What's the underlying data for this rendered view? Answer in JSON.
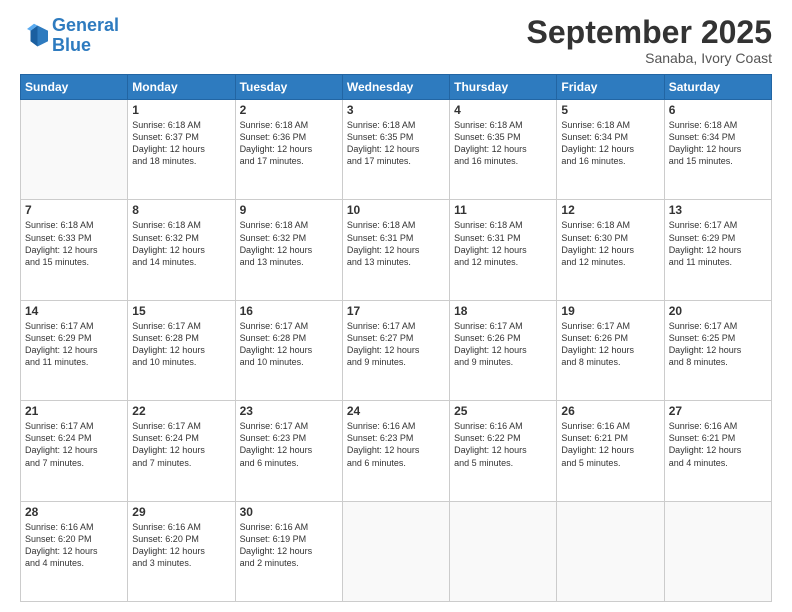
{
  "logo": {
    "line1": "General",
    "line2": "Blue"
  },
  "title": "September 2025",
  "location": "Sanaba, Ivory Coast",
  "days_header": [
    "Sunday",
    "Monday",
    "Tuesday",
    "Wednesday",
    "Thursday",
    "Friday",
    "Saturday"
  ],
  "weeks": [
    [
      {
        "day": "",
        "info": ""
      },
      {
        "day": "1",
        "info": "Sunrise: 6:18 AM\nSunset: 6:37 PM\nDaylight: 12 hours\nand 18 minutes."
      },
      {
        "day": "2",
        "info": "Sunrise: 6:18 AM\nSunset: 6:36 PM\nDaylight: 12 hours\nand 17 minutes."
      },
      {
        "day": "3",
        "info": "Sunrise: 6:18 AM\nSunset: 6:35 PM\nDaylight: 12 hours\nand 17 minutes."
      },
      {
        "day": "4",
        "info": "Sunrise: 6:18 AM\nSunset: 6:35 PM\nDaylight: 12 hours\nand 16 minutes."
      },
      {
        "day": "5",
        "info": "Sunrise: 6:18 AM\nSunset: 6:34 PM\nDaylight: 12 hours\nand 16 minutes."
      },
      {
        "day": "6",
        "info": "Sunrise: 6:18 AM\nSunset: 6:34 PM\nDaylight: 12 hours\nand 15 minutes."
      }
    ],
    [
      {
        "day": "7",
        "info": "Sunrise: 6:18 AM\nSunset: 6:33 PM\nDaylight: 12 hours\nand 15 minutes."
      },
      {
        "day": "8",
        "info": "Sunrise: 6:18 AM\nSunset: 6:32 PM\nDaylight: 12 hours\nand 14 minutes."
      },
      {
        "day": "9",
        "info": "Sunrise: 6:18 AM\nSunset: 6:32 PM\nDaylight: 12 hours\nand 13 minutes."
      },
      {
        "day": "10",
        "info": "Sunrise: 6:18 AM\nSunset: 6:31 PM\nDaylight: 12 hours\nand 13 minutes."
      },
      {
        "day": "11",
        "info": "Sunrise: 6:18 AM\nSunset: 6:31 PM\nDaylight: 12 hours\nand 12 minutes."
      },
      {
        "day": "12",
        "info": "Sunrise: 6:18 AM\nSunset: 6:30 PM\nDaylight: 12 hours\nand 12 minutes."
      },
      {
        "day": "13",
        "info": "Sunrise: 6:17 AM\nSunset: 6:29 PM\nDaylight: 12 hours\nand 11 minutes."
      }
    ],
    [
      {
        "day": "14",
        "info": "Sunrise: 6:17 AM\nSunset: 6:29 PM\nDaylight: 12 hours\nand 11 minutes."
      },
      {
        "day": "15",
        "info": "Sunrise: 6:17 AM\nSunset: 6:28 PM\nDaylight: 12 hours\nand 10 minutes."
      },
      {
        "day": "16",
        "info": "Sunrise: 6:17 AM\nSunset: 6:28 PM\nDaylight: 12 hours\nand 10 minutes."
      },
      {
        "day": "17",
        "info": "Sunrise: 6:17 AM\nSunset: 6:27 PM\nDaylight: 12 hours\nand 9 minutes."
      },
      {
        "day": "18",
        "info": "Sunrise: 6:17 AM\nSunset: 6:26 PM\nDaylight: 12 hours\nand 9 minutes."
      },
      {
        "day": "19",
        "info": "Sunrise: 6:17 AM\nSunset: 6:26 PM\nDaylight: 12 hours\nand 8 minutes."
      },
      {
        "day": "20",
        "info": "Sunrise: 6:17 AM\nSunset: 6:25 PM\nDaylight: 12 hours\nand 8 minutes."
      }
    ],
    [
      {
        "day": "21",
        "info": "Sunrise: 6:17 AM\nSunset: 6:24 PM\nDaylight: 12 hours\nand 7 minutes."
      },
      {
        "day": "22",
        "info": "Sunrise: 6:17 AM\nSunset: 6:24 PM\nDaylight: 12 hours\nand 7 minutes."
      },
      {
        "day": "23",
        "info": "Sunrise: 6:17 AM\nSunset: 6:23 PM\nDaylight: 12 hours\nand 6 minutes."
      },
      {
        "day": "24",
        "info": "Sunrise: 6:16 AM\nSunset: 6:23 PM\nDaylight: 12 hours\nand 6 minutes."
      },
      {
        "day": "25",
        "info": "Sunrise: 6:16 AM\nSunset: 6:22 PM\nDaylight: 12 hours\nand 5 minutes."
      },
      {
        "day": "26",
        "info": "Sunrise: 6:16 AM\nSunset: 6:21 PM\nDaylight: 12 hours\nand 5 minutes."
      },
      {
        "day": "27",
        "info": "Sunrise: 6:16 AM\nSunset: 6:21 PM\nDaylight: 12 hours\nand 4 minutes."
      }
    ],
    [
      {
        "day": "28",
        "info": "Sunrise: 6:16 AM\nSunset: 6:20 PM\nDaylight: 12 hours\nand 4 minutes."
      },
      {
        "day": "29",
        "info": "Sunrise: 6:16 AM\nSunset: 6:20 PM\nDaylight: 12 hours\nand 3 minutes."
      },
      {
        "day": "30",
        "info": "Sunrise: 6:16 AM\nSunset: 6:19 PM\nDaylight: 12 hours\nand 2 minutes."
      },
      {
        "day": "",
        "info": ""
      },
      {
        "day": "",
        "info": ""
      },
      {
        "day": "",
        "info": ""
      },
      {
        "day": "",
        "info": ""
      }
    ]
  ]
}
